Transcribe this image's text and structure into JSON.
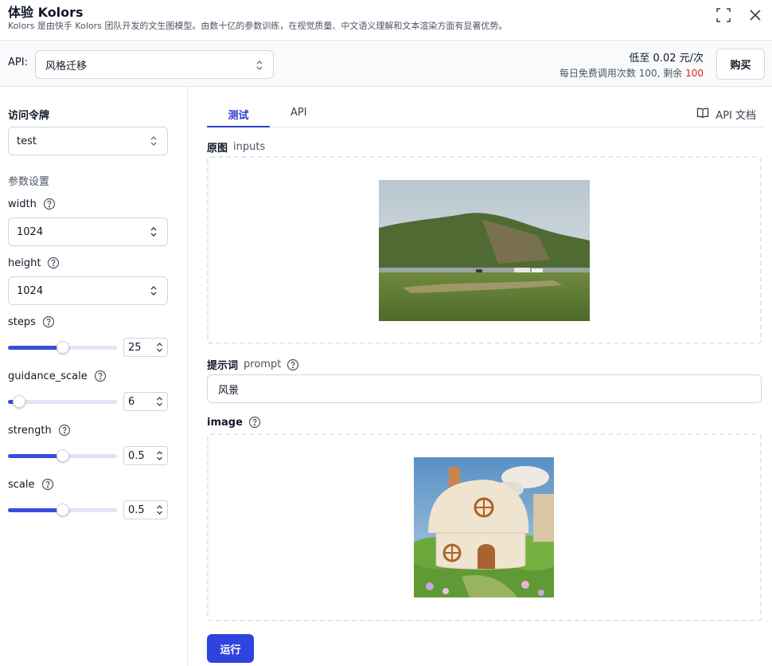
{
  "header": {
    "title": "体验  Kolors",
    "subtitle": "Kolors 是由快手 Kolors 团队开发的文生图模型。由数十亿的参数训练，在视觉质量、中文语义理解和文本渲染方面有显著优势。"
  },
  "api_bar": {
    "label": "API:",
    "selected": "风格迁移",
    "price": "低至 0.02 元/次",
    "quota_prefix": "每日免费调用次数 100, 剩余 ",
    "quota_remaining": "100",
    "buy_label": "购买"
  },
  "sidebar": {
    "token_label": "访问令牌",
    "token_value": "test",
    "params_label": "参数设置",
    "width": {
      "label": "width",
      "value": "1024"
    },
    "height": {
      "label": "height",
      "value": "1024"
    },
    "steps": {
      "label": "steps",
      "value": "25",
      "fraction": 0.5
    },
    "guidance_scale": {
      "label": "guidance_scale",
      "value": "6",
      "fraction": 0.1
    },
    "strength": {
      "label": "strength",
      "value": "0.5",
      "fraction": 0.5
    },
    "scale": {
      "label": "scale",
      "value": "0.5",
      "fraction": 0.5
    }
  },
  "main": {
    "tabs": [
      {
        "label": "测试"
      },
      {
        "label": "API"
      }
    ],
    "docs_label": "API 文档",
    "original_label": "原图",
    "original_key": "inputs",
    "prompt_label": "提示词",
    "prompt_key": "prompt",
    "prompt_value": "风景",
    "image_label": "image",
    "run_label": "运行"
  },
  "colors": {
    "accent": "#3040d4",
    "slider_fill": "#3b4ddb",
    "quota_red": "#dc2626"
  }
}
